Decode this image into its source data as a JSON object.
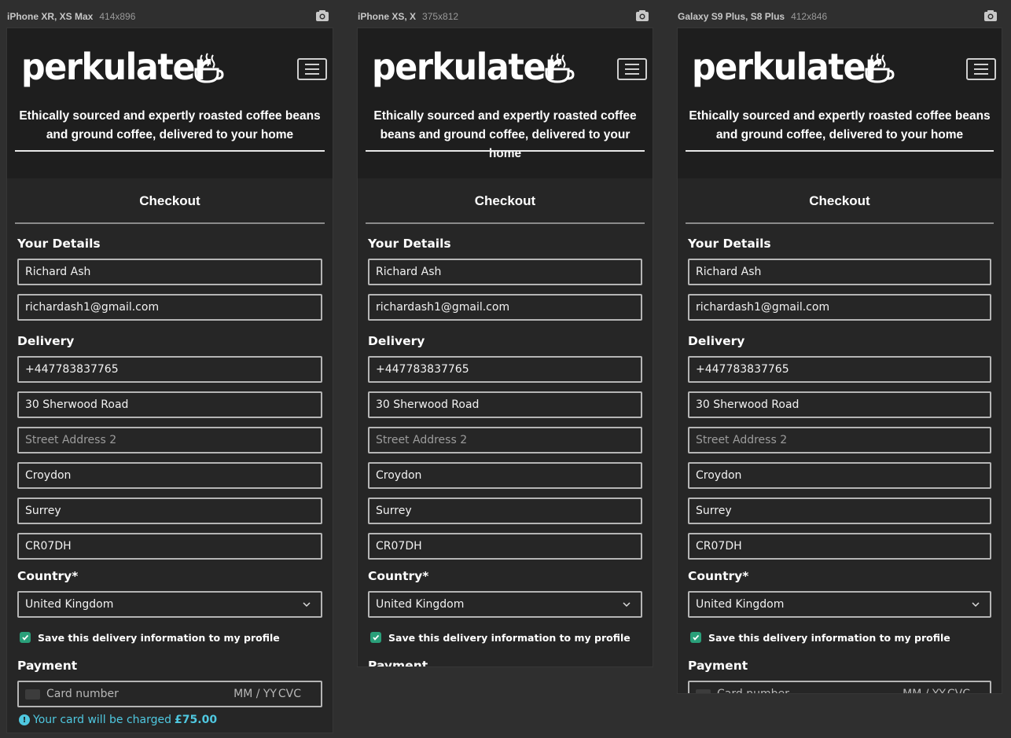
{
  "devices": [
    {
      "name": "iPhone XR, XS Max",
      "dims": "414x896"
    },
    {
      "name": "iPhone XS, X",
      "dims": "375x812"
    },
    {
      "name": "Galaxy S9 Plus, S8 Plus",
      "dims": "412x846"
    }
  ],
  "site": {
    "logo_text": "perkulater",
    "tagline": "Ethically sourced and expertly roasted coffee beans and ground coffee, delivered to your home"
  },
  "checkout": {
    "title": "Checkout",
    "your_details_title": "Your Details",
    "full_name": "Richard Ash",
    "email": "richardash1@gmail.com",
    "delivery_title": "Delivery",
    "phone": "+447783837765",
    "street_address1": "30 Sherwood Road",
    "street_address2_placeholder": "Street Address 2",
    "town": "Croydon",
    "county": "Surrey",
    "postcode": "CR07DH",
    "country_label": "Country*",
    "country_value": "United Kingdom",
    "save_info_label": "Save this delivery information to my profile",
    "save_info_checked": true,
    "payment_title": "Payment",
    "card_number_placeholder": "Card number",
    "card_expiry_placeholder": "MM / YY",
    "card_cvc_placeholder": "CVC",
    "charge_prefix": "Your card will be charged",
    "charge_amount": "£75.00"
  },
  "colors": {
    "background": "#2f2f2f",
    "panel": "#262626",
    "header": "#1e1e1e",
    "checkbox": "#2aa07a",
    "info": "#4fc8e0"
  }
}
